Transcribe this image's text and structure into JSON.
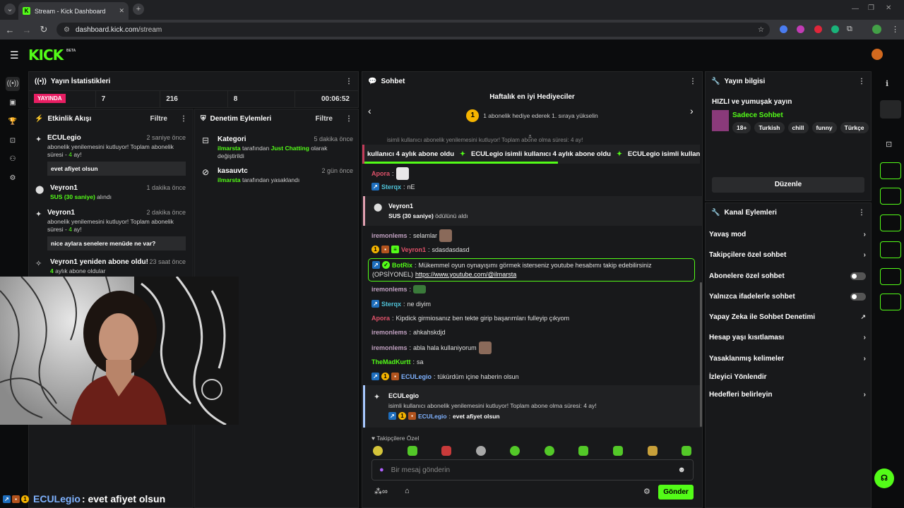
{
  "browser": {
    "tab_title": "Stream - Kick Dashboard",
    "url_domain": "dashboard.kick.com",
    "url_path": "/stream"
  },
  "kick": {
    "logo": "KICK",
    "beta": "BETA"
  },
  "stats": {
    "title": "Yayın İstatistikleri",
    "live_label": "YAYINDA",
    "values": [
      "7",
      "216",
      "8",
      "00:06:52"
    ]
  },
  "activity": {
    "title": "Etkinlik Akışı",
    "filter": "Filtre",
    "items": [
      {
        "name": "ECULegio",
        "time": "2 saniye önce",
        "line1": "abonelik yenilemesini kutluyor! Toplam abonelik",
        "line2a": "süresi - ",
        "line2b": "4",
        "line2c": " ay!",
        "quote": "evet afiyet olsun"
      },
      {
        "name": "Veyron1",
        "time": "1 dakika önce",
        "reward": "SUS (30 saniye)",
        "reward_suffix": " alındı"
      },
      {
        "name": "Veyron1",
        "time": "2 dakika önce",
        "line1": "abonelik yenilemesini kutluyor! Toplam abonelik",
        "line2a": "süresi - ",
        "line2b": "4",
        "line2c": " ay!",
        "quote": "nice aylara senelere menüde ne var?"
      },
      {
        "name": "Veyron1 yeniden abone oldu!",
        "time": "23 saat önce",
        "count": "4",
        "suffix": " aylık abone oldular"
      }
    ]
  },
  "moderation": {
    "title": "Denetim Eylemleri",
    "filter": "Filtre",
    "items": [
      {
        "title": "Kategori",
        "time": "5 dakika önce",
        "user": "ilmarsta",
        "mid": " tarafından ",
        "cat": "Just Chatting",
        "end": " olarak",
        "line2": "değiştirildi"
      },
      {
        "title": "kasauvtc",
        "time": "2 gün önce",
        "user": "ilmarsta",
        "end": " tarafından yasaklandı"
      }
    ]
  },
  "chat": {
    "title": "Sohbet",
    "gifters_title": "Haftalık en iyi Hediyeciler",
    "gifters_rank": "1",
    "gifters_text": "1 abonelik hediye ederek 1. sıraya yükselin",
    "top_partial": "isimli kullanıcı abonelik yenilemesini kutluyor! Toplam abone olma süresi: 4 ay!",
    "ticker": [
      "kullanıcı 4 aylık abone oldu",
      "ECULegio isimli kullanıcı 4 aylık abone oldu",
      "ECULegio isimli kullanıcı 4"
    ],
    "reward_user": "Veyron1",
    "reward_text": "SUS (30 saniye)",
    "reward_suffix": " ödülünü aldı",
    "messages": [
      {
        "user": "Apora",
        "text": ""
      },
      {
        "user": "Sterqx",
        "text": "nE"
      },
      {
        "user": "iremonlems",
        "text": "selamlar"
      },
      {
        "user": "Veyron1",
        "text": "sdasdasdasd"
      },
      {
        "user": "BotRix",
        "text": "Mükemmel oyun oynayışımı görmek isterseniz youtube hesabımı takip edebilirsiniz",
        "text2": "(OPSİYONEL) ",
        "link": "https://www.youtube.com/@ilmarsta"
      },
      {
        "user": "iremonlems",
        "text": ""
      },
      {
        "user": "Sterqx",
        "text": "ne diyim"
      },
      {
        "user": "Apora",
        "text": "Kipdick girmiosanız ben tekte girip başarımları fulleyip çıkyom"
      },
      {
        "user": "iremonlems",
        "text": "ahkahskdjd"
      },
      {
        "user": "iremonlems",
        "text": "abla hala kullaniyorum"
      },
      {
        "user": "TheMadKurtt",
        "text": "sa"
      },
      {
        "user": "ECULegio",
        "text": "tükürdüm içine haberin olsun"
      }
    ],
    "sub_user": "ECULegio",
    "sub_text": "isimli kullanıcı abonelik yenilemesini kutluyor! Toplam abone olma süresi: 4 ay!",
    "sub_quote_user": "ECULegio",
    "sub_quote": "evet afiyet olsun",
    "followers_label": "Takipçilere Özel",
    "placeholder": "Bir mesaj gönderin",
    "send": "Gönder"
  },
  "stream_info": {
    "title": "Yayın bilgisi",
    "stream_title": "HIZLI ve yumuşak yayın",
    "category": "Sadece Sohbet",
    "tags": [
      "18+",
      "Turkish",
      "chill",
      "funny",
      "Türkçe"
    ],
    "edit": "Düzenle"
  },
  "channel_actions": {
    "title": "Kanal Eylemleri",
    "items": [
      "Yavaş mod",
      "Takipçilere özel sohbet",
      "Abonelere özel sohbet",
      "Yalnızca ifadelerle sohbet",
      "Yapay Zeka ile Sohbet Denetimi",
      "Hesap yaşı kısıtlaması",
      "Yasaklanmış kelimeler",
      "İzleyici Yönlendir",
      "Hedefleri belirleyin"
    ]
  },
  "overlay": {
    "user": "ECULegio",
    "text": ": evet afiyet olsun"
  },
  "colors": {
    "kick_green": "#53fc18",
    "bot_border": "#53fc18",
    "live_red": "#e91e63"
  }
}
